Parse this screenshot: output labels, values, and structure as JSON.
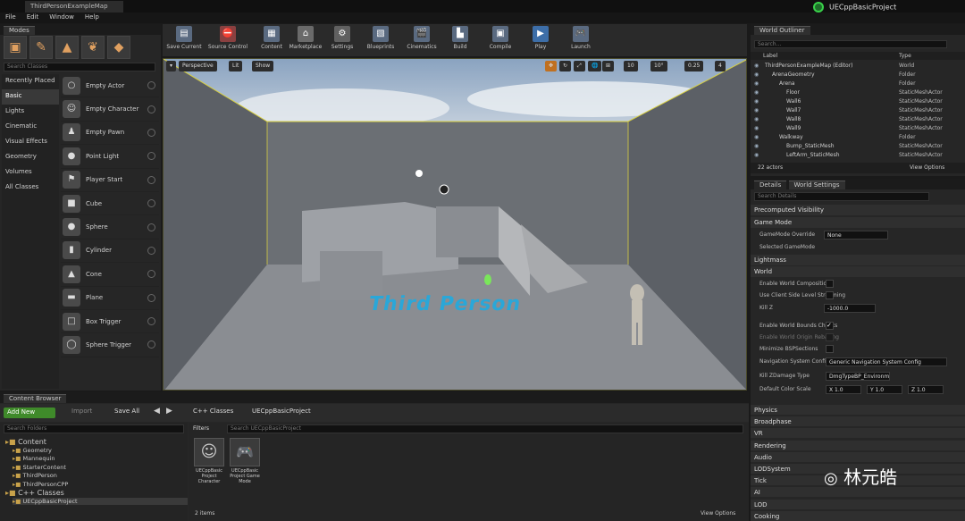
{
  "window": {
    "doc_tab": "ThirdPersonExampleMap",
    "project": "UECppBasicProject"
  },
  "menu": [
    "File",
    "Edit",
    "Window",
    "Help"
  ],
  "modes": {
    "tab": "Modes",
    "search_placeholder": "Search Classes",
    "categories": [
      "Recently Placed",
      "Basic",
      "Lights",
      "Cinematic",
      "Visual Effects",
      "Geometry",
      "Volumes",
      "All Classes"
    ],
    "items": [
      "Empty Actor",
      "Empty Character",
      "Empty Pawn",
      "Point Light",
      "Player Start",
      "Cube",
      "Sphere",
      "Cylinder",
      "Cone",
      "Plane",
      "Box Trigger",
      "Sphere Trigger"
    ]
  },
  "toolbar": [
    "Save Current",
    "Source Control",
    "Content",
    "Marketplace",
    "Settings",
    "Blueprints",
    "Cinematics",
    "Build",
    "Compile",
    "Play",
    "Launch"
  ],
  "viewport": {
    "perspective": "Perspective",
    "lit": "Lit",
    "show": "Show",
    "grid": "10",
    "rot": "10°",
    "scale": "0.25",
    "cam": "4",
    "text3d": "Third Person"
  },
  "outliner": {
    "tab": "World Outliner",
    "search_placeholder": "Search...",
    "col_label": "Label",
    "col_type": "Type",
    "rows": [
      {
        "label": "ThirdPersonExampleMap (Editor)",
        "type": "World",
        "indent": 0
      },
      {
        "label": "ArenaGeometry",
        "type": "Folder",
        "indent": 1
      },
      {
        "label": "Arena",
        "type": "Folder",
        "indent": 2
      },
      {
        "label": "Floor",
        "type": "StaticMeshActor",
        "indent": 3
      },
      {
        "label": "Wall6",
        "type": "StaticMeshActor",
        "indent": 3
      },
      {
        "label": "Wall7",
        "type": "StaticMeshActor",
        "indent": 3
      },
      {
        "label": "Wall8",
        "type": "StaticMeshActor",
        "indent": 3
      },
      {
        "label": "Wall9",
        "type": "StaticMeshActor",
        "indent": 3
      },
      {
        "label": "Walkway",
        "type": "Folder",
        "indent": 2
      },
      {
        "label": "Bump_StaticMesh",
        "type": "StaticMeshActor",
        "indent": 3
      },
      {
        "label": "LeftArm_StaticMesh",
        "type": "StaticMeshActor",
        "indent": 3
      }
    ],
    "count": "22 actors",
    "view_options": "View Options"
  },
  "details": {
    "tab_details": "Details",
    "tab_world": "World Settings",
    "search_placeholder": "Search Details",
    "sec_precomputed": "Precomputed Visibility",
    "sec_gamemode": "Game Mode",
    "gm_override": "GameMode Override",
    "gm_value": "None",
    "selected_gm": "Selected GameMode",
    "sec_lightmass": "Lightmass",
    "sec_world": "World",
    "p_enable_comp": "Enable World Composition",
    "p_client_side": "Use Client Side Level Streaming",
    "p_killz": "Kill Z",
    "v_killz": "-1000.0",
    "p_bounds": "Enable World Bounds Checks",
    "p_origin": "Enable World Origin Rebasing",
    "p_minimize": "Minimize BSPSections",
    "p_nav": "Navigation System Config",
    "v_nav": "Generic Navigation System Config",
    "p_killdmg": "Kill ZDamage Type",
    "v_killdmg": "DmgTypeBP_Environmental",
    "p_color": "Default Color Scale",
    "vx": "1.0",
    "vy": "1.0",
    "vz": "1.0",
    "sections": [
      "Physics",
      "Broadphase",
      "VR",
      "Rendering",
      "Audio",
      "LODSystem",
      "Tick",
      "AI",
      "LOD",
      "Cooking"
    ]
  },
  "content": {
    "tab": "Content Browser",
    "add_new": "Add New",
    "import": "Import",
    "save_all": "Save All",
    "path_root": "C++ Classes",
    "path_leaf": "UECppBasicProject",
    "search_folders": "Search Folders",
    "filters": "Filters",
    "search_assets": "Search UECppBasicProject",
    "folders": [
      "Content",
      "Geometry",
      "Mannequin",
      "StarterContent",
      "ThirdPerson",
      "ThirdPersonCPP",
      "C++ Classes",
      "UECppBasicProject"
    ],
    "assets": [
      "UECppBasic Project Character",
      "UECppBasic Project Game Mode"
    ],
    "items_count": "2 items",
    "view_options": "View Options"
  },
  "watermark": "林元皓"
}
